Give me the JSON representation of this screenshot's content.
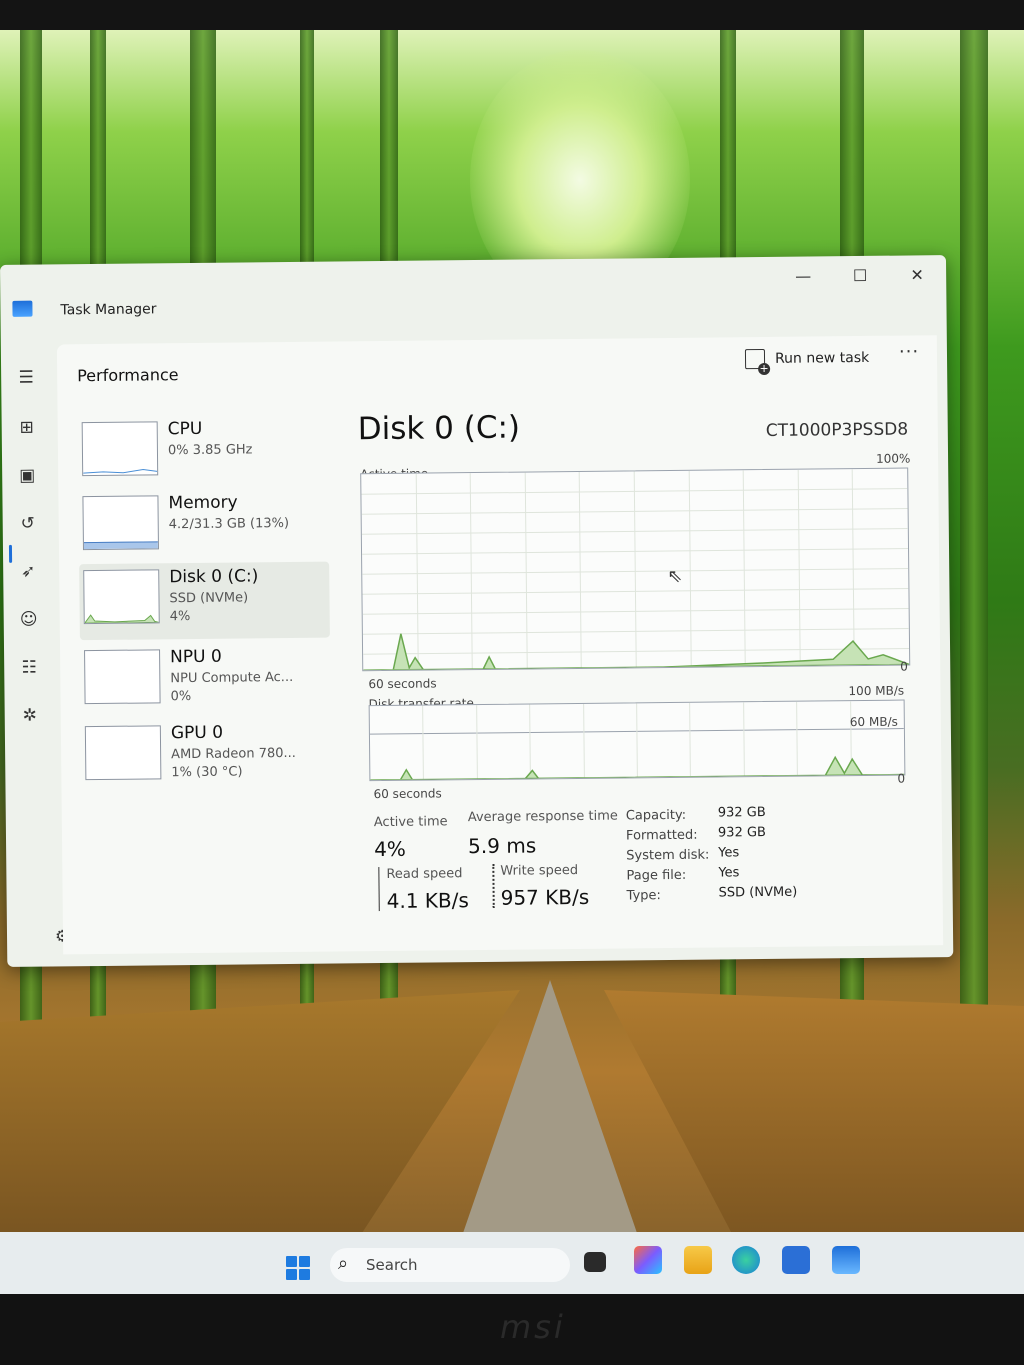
{
  "window": {
    "title": "Task Manager",
    "minimize": "—",
    "maximize": "☐",
    "close": "✕"
  },
  "header": {
    "section_title": "Performance",
    "run_new_task": "Run new task",
    "more": "···"
  },
  "devices": [
    {
      "name": "CPU",
      "sub1": "0% 3.85 GHz",
      "sub2": ""
    },
    {
      "name": "Memory",
      "sub1": "4.2/31.3 GB (13%)",
      "sub2": ""
    },
    {
      "name": "Disk 0 (C:)",
      "sub1": "SSD (NVMe)",
      "sub2": "4%"
    },
    {
      "name": "NPU 0",
      "sub1": "NPU Compute Ac...",
      "sub2": "0%"
    },
    {
      "name": "GPU 0",
      "sub1": "AMD Radeon 780...",
      "sub2": "1% (30 °C)"
    }
  ],
  "detail": {
    "title": "Disk 0 (C:)",
    "model": "CT1000P3PSSD8",
    "active_time_label": "Active time",
    "active_time_max": "100%",
    "active_time_min": "0",
    "seconds_label": "60 seconds",
    "transfer_label": "Disk transfer rate",
    "transfer_max": "100 MB/s",
    "transfer_mid": "60 MB/s",
    "transfer_min": "0",
    "seconds_label_2": "60 seconds"
  },
  "stats": {
    "active_time": {
      "label": "Active time",
      "value": "4%"
    },
    "avg_response": {
      "label": "Average response time",
      "value": "5.9 ms"
    },
    "read_speed": {
      "label": "Read speed",
      "value": "4.1 KB/s"
    },
    "write_speed": {
      "label": "Write speed",
      "value": "957 KB/s"
    }
  },
  "properties": [
    {
      "key": "Capacity:",
      "value": "932 GB"
    },
    {
      "key": "Formatted:",
      "value": "932 GB"
    },
    {
      "key": "System disk:",
      "value": "Yes"
    },
    {
      "key": "Page file:",
      "value": "Yes"
    },
    {
      "key": "Type:",
      "value": "SSD (NVMe)"
    }
  ],
  "nav_icons": [
    "menu-icon",
    "processes-icon",
    "performance-icon",
    "app-history-icon",
    "startup-apps-icon",
    "users-icon",
    "details-icon",
    "services-icon",
    "settings-icon"
  ],
  "taskbar": {
    "search_placeholder": "Search"
  },
  "bezel": {
    "brand": "msi"
  },
  "colors": {
    "accent": "#1e6fd9",
    "graph_line": "#6aa84f",
    "graph_fill": "#c6e3b6"
  }
}
